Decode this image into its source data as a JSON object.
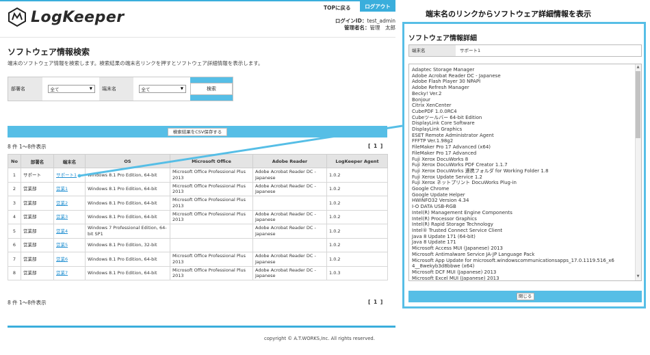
{
  "header": {
    "logo_text": "LogKeeper",
    "top_link": "TOPに戻る",
    "logout": "ログアウト",
    "login_label": "ログインID：",
    "login_id": "test_admin",
    "admin_label": "管理者名：",
    "admin_name": "管理　太郎"
  },
  "search": {
    "title": "ソフトウェア情報検索",
    "description": "端末のソフトウェア情報を検索します。検索結果の端末名リンクを押すとソフトウェア詳細情報を表示します。",
    "dept_label": "部署名",
    "dept_value": "全て",
    "terminal_label": "端末名",
    "terminal_value": "全て",
    "search_button": "検索"
  },
  "csv_button": "検索結果をCSV保存する",
  "count_text": "8 件  1～8件表示",
  "pager": "[ 1 ]",
  "table": {
    "headers": [
      "No",
      "部署名",
      "端末名",
      "OS",
      "Microsoft Office",
      "Adobe Reader",
      "LogKeeper Agent"
    ],
    "rows": [
      [
        "1",
        "サポート",
        "サポート1",
        "Windows 8.1 Pro Edition, 64-bit",
        "Microsoft Office Professional Plus 2013",
        "Adobe Acrobat Reader DC - Japanese",
        "1.0.2"
      ],
      [
        "2",
        "営業部",
        "営業1",
        "Windows 8.1 Pro Edition, 64-bit",
        "Microsoft Office Professional Plus 2013",
        "Adobe Acrobat Reader DC - Japanese",
        "1.0.2"
      ],
      [
        "3",
        "営業部",
        "営業2",
        "Windows 8.1 Pro Edition, 64-bit",
        "Microsoft Office Professional Plus 2013",
        "",
        "1.0.2"
      ],
      [
        "4",
        "営業部",
        "営業3",
        "Windows 8.1 Pro Edition, 64-bit",
        "Microsoft Office Professional Plus 2013",
        "Adobe Acrobat Reader DC - Japanese",
        "1.0.2"
      ],
      [
        "5",
        "営業部",
        "営業4",
        "Windows 7 Professional Edition, 64-bit SP1",
        "",
        "Adobe Acrobat Reader DC - Japanese",
        "1.0.2"
      ],
      [
        "6",
        "営業部",
        "営業5",
        "Windows 8.1 Pro Edition, 32-bit",
        "",
        "",
        "1.0.2"
      ],
      [
        "7",
        "営業部",
        "営業6",
        "Windows 8.1 Pro Edition, 64-bit",
        "Microsoft Office Professional Plus 2013",
        "Adobe Acrobat Reader DC - Japanese",
        "1.0.2"
      ],
      [
        "8",
        "営業部",
        "営業7",
        "Windows 8.1 Pro Edition, 64-bit",
        "Microsoft Office Professional Plus 2013",
        "Adobe Acrobat Reader DC - Japanese",
        "1.0.3"
      ]
    ]
  },
  "footer": {
    "copyright": "copyright © A.T.WORKS,Inc. All rights reserved."
  },
  "callout": "端末名のリンクからソフトウェア詳細情報を表示",
  "detail": {
    "title": "ソフトウェア情報詳細",
    "terminal_label": "端末名",
    "terminal_value": "サポート1",
    "software": [
      "Adaptec Storage Manager",
      "Adobe Acrobat Reader DC - Japanese",
      "Adobe Flash Player 30 NPAPI",
      "Adobe Refresh Manager",
      "Becky! Ver.2",
      "Bonjour",
      "Citrix XenCenter",
      "CubePDF 1.0.0RC4",
      "Cubeツールバー 64-bit Edition",
      "DisplayLink Core Software",
      "DisplayLink Graphics",
      "ESET Remote Administrator Agent",
      "FFFTP Ver.1.98g2",
      "FileMaker Pro 17 Advanced (x64)",
      "FileMaker Pro 17 Advanced",
      "Fuji Xerox DocuWorks 8",
      "Fuji Xerox DocuWorks PDF Creator 1.1.7",
      "Fuji Xerox DocuWorks 連携フォルダ for Working Folder 1.8",
      "Fuji Xerox Update Service 1.2",
      "Fuji Xerox ネットプリント DocuWorks Plug-in",
      "Google Chrome",
      "Google Update Helper",
      "HWiNFO32 Version 4.34",
      "I-O DATA USB-RGB",
      "Intel(R) Management Engine Components",
      "Intel(R) Processor Graphics",
      "Intel(R) Rapid Storage Technology",
      "Intel® Trusted Connect Service Client",
      "Java 8 Update 171 (64-bit)",
      "Java 8 Update 171",
      "Microsoft Access MUI (Japanese) 2013",
      "Microsoft Antimalware Service JA-JP Language Pack",
      "Microsoft App Update for microsoft.windowscommunicationsapps_17.0.1119.516_x6",
      "4__8wekyb3d8bbwe (x64)",
      "Microsoft DCF MUI (Japanese) 2013",
      "Microsoft Excel MUI (Japanese) 2013"
    ],
    "close_button": "閉じる"
  },
  "colors": {
    "accent": "#56bee6",
    "link": "#1f8ed1",
    "header_bg": "#e4e4e4"
  }
}
